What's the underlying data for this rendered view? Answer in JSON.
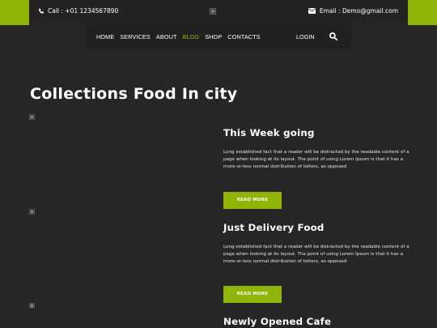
{
  "topbar": {
    "phone": "Call : +01 1234567890",
    "email": "Email : Demo@gmail.com"
  },
  "nav": {
    "items": [
      "HOME",
      "SERVICES",
      "ABOUT",
      "BLOG",
      "SHOP",
      "CONTACTS"
    ],
    "active": "BLOG",
    "login": "LOGIN"
  },
  "page": {
    "title": "Collections Food In city"
  },
  "posts": [
    {
      "title": "This Week going",
      "text": "Long established fact that a reader will be distracted by the readable content of a page when looking at its layout. The point of using Lorem Ipsum is that it has a more-or-less normal distribution of letters, as opposed",
      "button": "READ MORE"
    },
    {
      "title": "Just Delivery Food",
      "text": "Long established fact that a reader will be distracted by the readable content of a page when looking at its layout. The point of using Lorem Ipsum is that it has a more-or-less normal distribution of letters, as opposed",
      "button": "READ MORE"
    },
    {
      "title": "Newly Opened Cafe"
    }
  ],
  "colors": {
    "accent": "#90b507",
    "background": "#262626",
    "bar": "#232323"
  },
  "icons": {
    "phone": "phone-icon",
    "email": "envelope-icon",
    "search": "search-icon",
    "image": "broken-image-icon"
  }
}
